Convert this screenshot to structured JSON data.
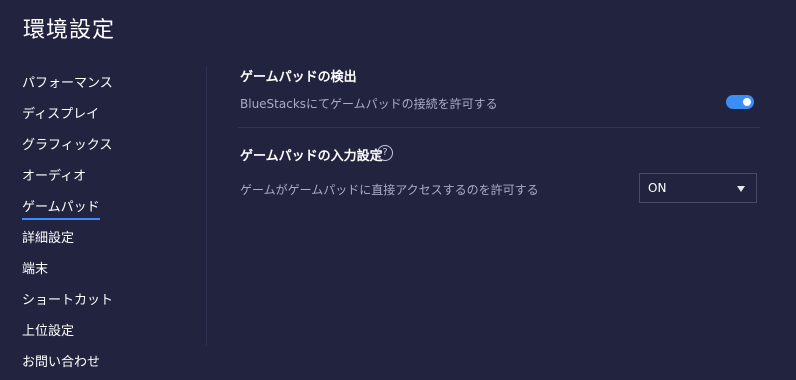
{
  "page": {
    "title": "環境設定"
  },
  "sidebar": {
    "items": [
      {
        "label": "パフォーマンス"
      },
      {
        "label": "ディスプレイ"
      },
      {
        "label": "グラフィックス"
      },
      {
        "label": "オーディオ"
      },
      {
        "label": "ゲームパッド",
        "active": true
      },
      {
        "label": "詳細設定"
      },
      {
        "label": "端末"
      },
      {
        "label": "ショートカット"
      },
      {
        "label": "上位設定"
      },
      {
        "label": "お問い合わせ"
      }
    ]
  },
  "main": {
    "detection": {
      "title": "ゲームパッドの検出",
      "label": "BlueStacksにてゲームパッドの接続を許可する",
      "toggle_on": true
    },
    "input": {
      "title": "ゲームパッドの入力設定",
      "help_icon": "help-icon",
      "label": "ゲームがゲームパッドに直接アクセスするのを許可する",
      "select_value": "ON"
    }
  },
  "colors": {
    "background": "#22243f",
    "accent": "#3a8ef6"
  }
}
